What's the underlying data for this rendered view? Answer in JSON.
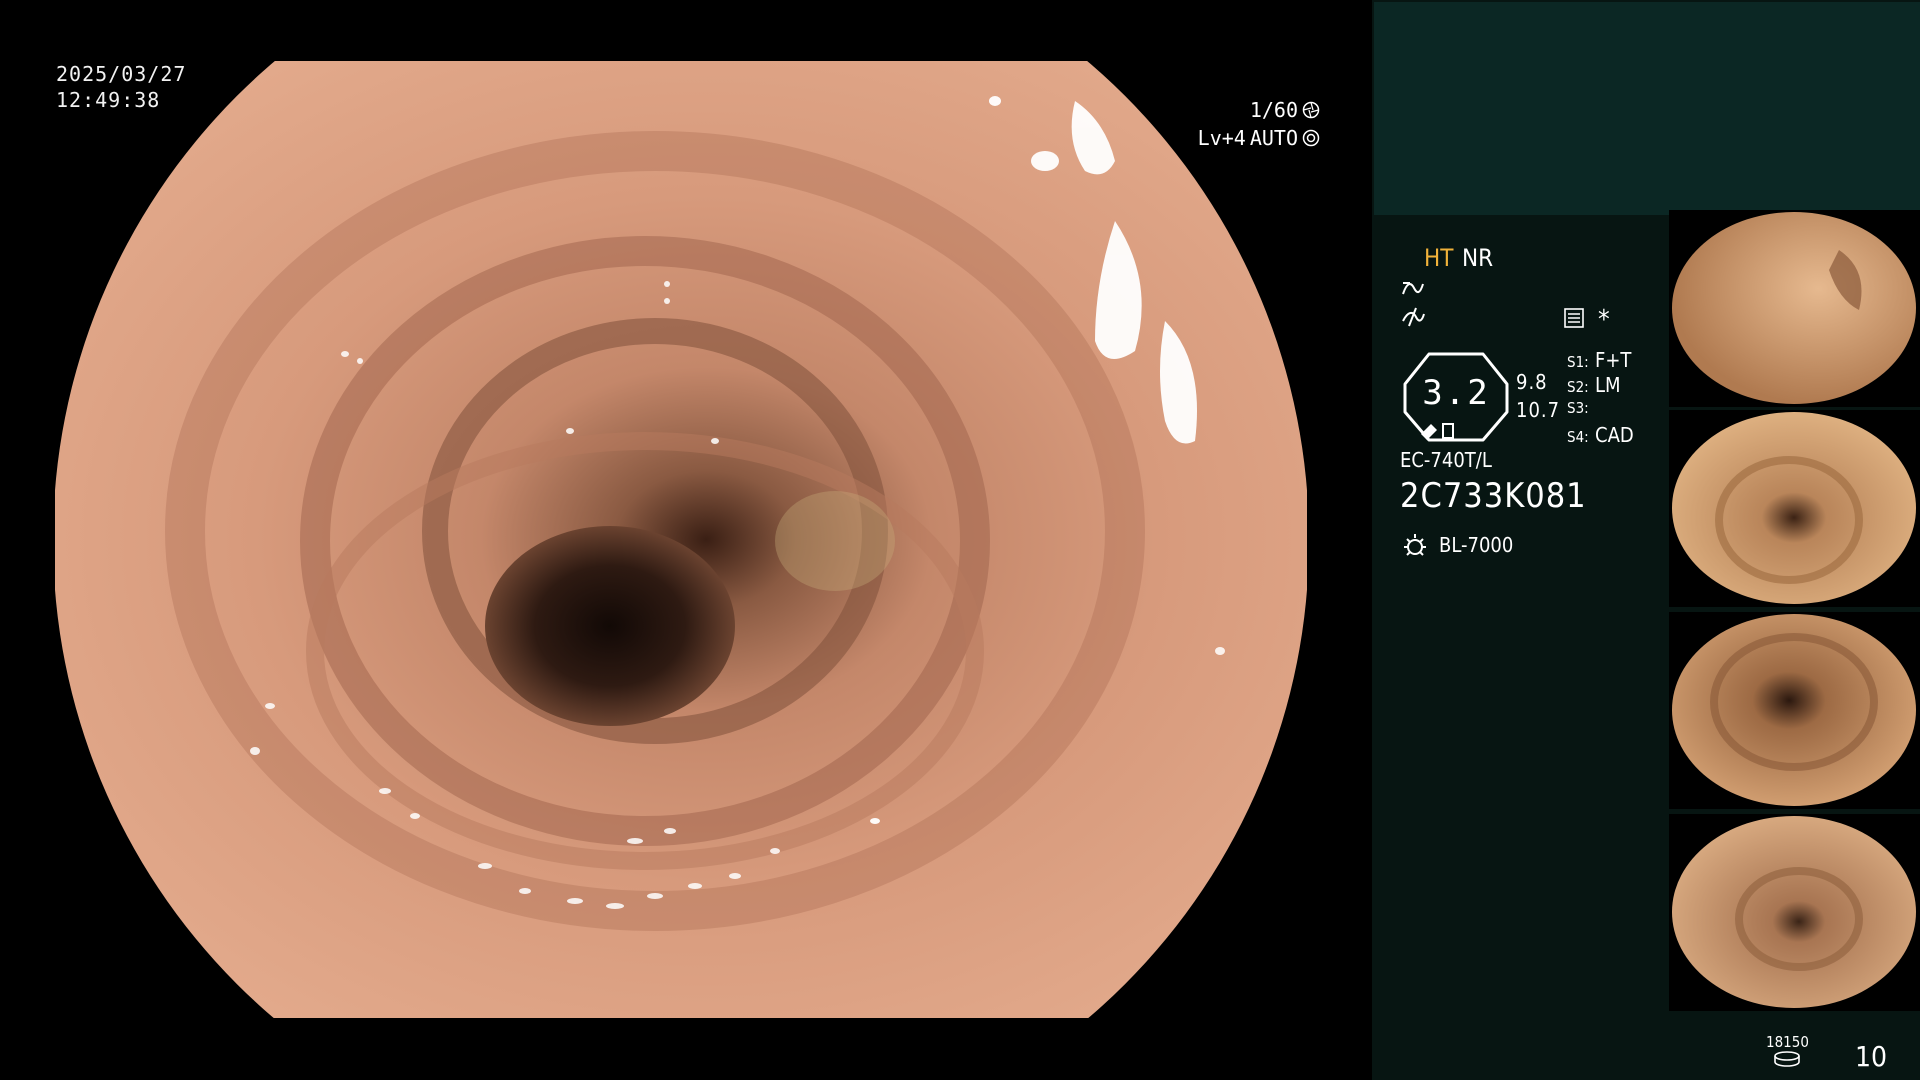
{
  "overlay": {
    "date": "2025/03/27",
    "time": "12:49:38",
    "shutter": "1/60",
    "level": "Lv+4",
    "mode": "AUTO"
  },
  "panel": {
    "ht_label": "HT",
    "nr_label": "NR",
    "asterisk": "*",
    "gauge_value": "3.2",
    "gauge_sub1": "9.8",
    "gauge_sub2": "10.7",
    "scope_switches": [
      {
        "key": "S1:",
        "value": "F+T"
      },
      {
        "key": "S2:",
        "value": "LM"
      },
      {
        "key": "S3:",
        "value": ""
      },
      {
        "key": "S4:",
        "value": "CAD"
      }
    ],
    "scope_model": "EC-740T/L",
    "scope_serial": "2C733K081",
    "light_source": "BL-7000",
    "image_counter_small": "18150",
    "image_counter": "10"
  },
  "colors": {
    "panel_bg": "#071512",
    "panel_top_bg": "#0b2724",
    "accent_ht": "#f0b23a",
    "tissue": "#d9987a"
  },
  "icons": [
    "shutter-aperture-icon",
    "auto-iris-icon",
    "enhance-curve-icon",
    "noise-icon",
    "menu-icon",
    "gauge-icon",
    "lamp-icon",
    "storage-icon"
  ]
}
